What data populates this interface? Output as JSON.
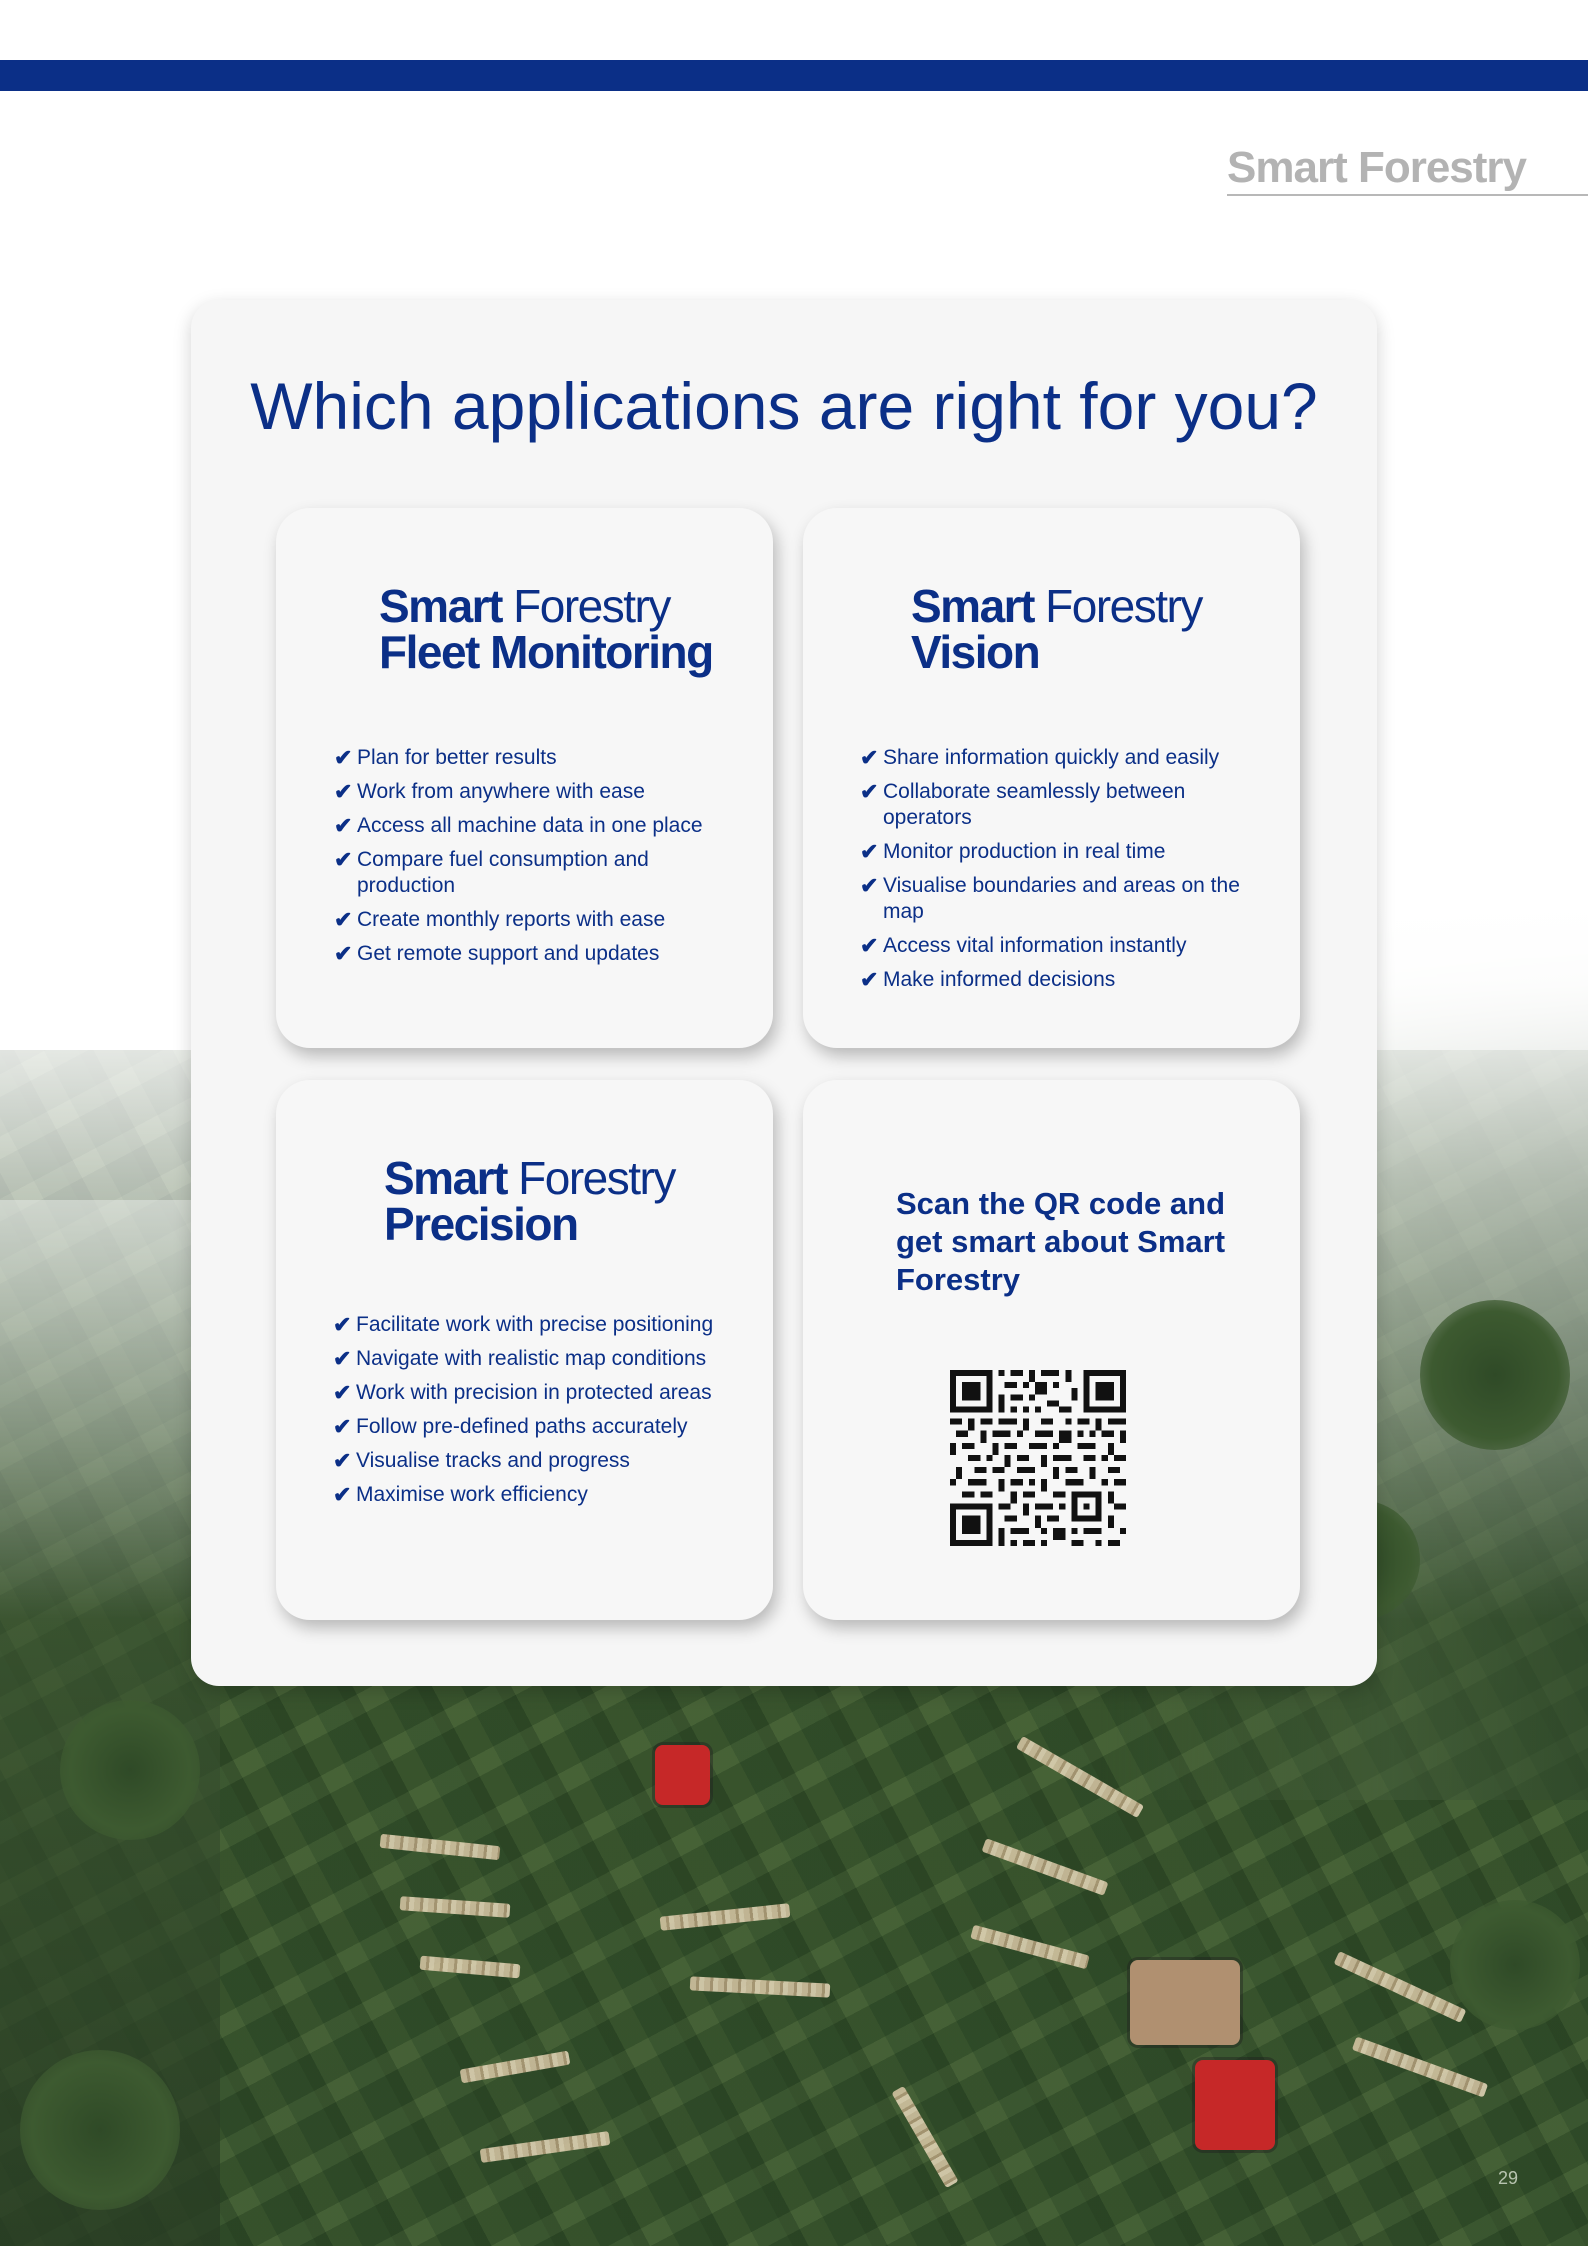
{
  "header": {
    "brand": "Smart Forestry"
  },
  "panel": {
    "title": "Which applications are right for you?"
  },
  "cards": [
    {
      "logo_prefix": "Smart",
      "logo_suffix": "Forestry",
      "logo_product": "Fleet Monitoring",
      "features": [
        "Plan for better results",
        "Work from anywhere with ease",
        "Access all machine data in one place",
        "Compare fuel consumption and production",
        "Create monthly reports with ease",
        "Get remote support and updates"
      ]
    },
    {
      "logo_prefix": "Smart",
      "logo_suffix": "Forestry",
      "logo_product": "Vision",
      "features": [
        "Share information quickly and easily",
        "Collaborate seamlessly between operators",
        "Monitor production in real time",
        "Visualise boundaries and areas on the map",
        "Access vital information instantly",
        "Make informed decisions"
      ]
    },
    {
      "logo_prefix": "Smart",
      "logo_suffix": "Forestry",
      "logo_product": "Precision",
      "features": [
        "Facilitate work with precise positioning",
        "Navigate with realistic map conditions",
        "Work with precision in protected areas",
        "Follow pre-defined paths accurately",
        "Visualise tracks and progress",
        "Maximise work efficiency"
      ]
    }
  ],
  "qr_card": {
    "title": "Scan the QR code and get smart about Smart Forestry"
  },
  "check_mark": "✔",
  "page_number": "29",
  "colors": {
    "brand_blue": "#0b2f87",
    "header_gray": "#b3b3b3",
    "panel_bg": "#f6f6f6"
  }
}
